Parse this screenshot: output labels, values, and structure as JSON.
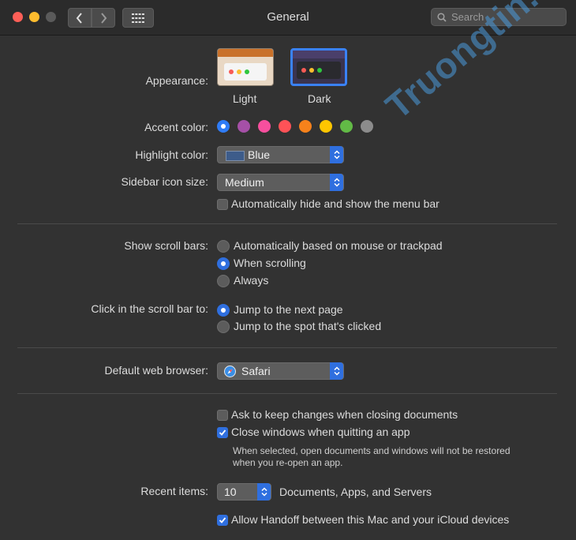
{
  "window": {
    "title": "General",
    "search_placeholder": "Search"
  },
  "appearance": {
    "label": "Appearance:",
    "options": [
      {
        "name": "Light",
        "selected": false
      },
      {
        "name": "Dark",
        "selected": true
      }
    ]
  },
  "accent": {
    "label": "Accent color:",
    "colors": [
      "#2f7cf6",
      "#a550a7",
      "#f74f9e",
      "#ff5257",
      "#f7821b",
      "#ffc600",
      "#62ba46",
      "#8c8c8c"
    ],
    "selected_index": 0
  },
  "highlight": {
    "label": "Highlight color:",
    "value": "Blue",
    "swatch": "#3d5c8a"
  },
  "sidebar_icon": {
    "label": "Sidebar icon size:",
    "value": "Medium"
  },
  "menu_bar": {
    "label": "Automatically hide and show the menu bar",
    "checked": false
  },
  "scroll_bars": {
    "label": "Show scroll bars:",
    "options": [
      {
        "label": "Automatically based on mouse or trackpad",
        "selected": false
      },
      {
        "label": "When scrolling",
        "selected": true
      },
      {
        "label": "Always",
        "selected": false
      }
    ]
  },
  "click_scroll": {
    "label": "Click in the scroll bar to:",
    "options": [
      {
        "label": "Jump to the next page",
        "selected": true
      },
      {
        "label": "Jump to the spot that's clicked",
        "selected": false
      }
    ]
  },
  "browser": {
    "label": "Default web browser:",
    "value": "Safari"
  },
  "documents": {
    "ask_keep_changes": {
      "label": "Ask to keep changes when closing documents",
      "checked": false
    },
    "close_windows": {
      "label": "Close windows when quitting an app",
      "checked": true
    },
    "note_line1": "When selected, open documents and windows will not be restored",
    "note_line2": "when you re-open an app."
  },
  "recent": {
    "label": "Recent items:",
    "value": "10",
    "suffix": "Documents, Apps, and Servers"
  },
  "handoff": {
    "label": "Allow Handoff between this Mac and your iCloud devices",
    "checked": true
  },
  "watermark": "Truongtin.top"
}
